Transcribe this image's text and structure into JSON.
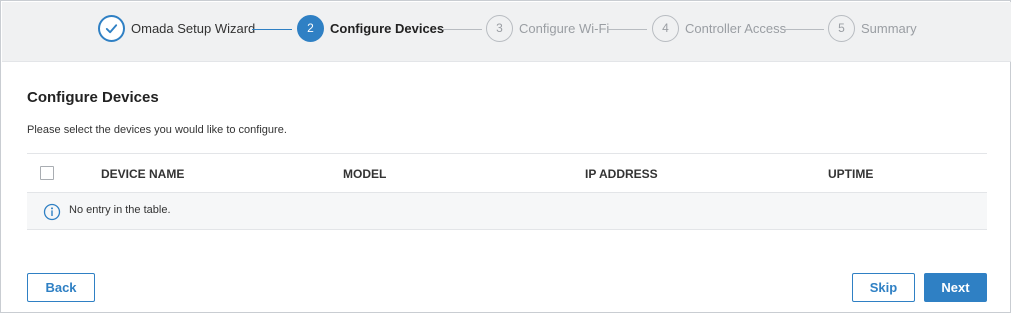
{
  "wizard": {
    "steps": [
      {
        "number": "",
        "label": "Omada Setup Wizard",
        "state": "done"
      },
      {
        "number": "2",
        "label": "Configure Devices",
        "state": "active"
      },
      {
        "number": "3",
        "label": "Configure Wi-Fi",
        "state": "todo"
      },
      {
        "number": "4",
        "label": "Controller Access",
        "state": "todo"
      },
      {
        "number": "5",
        "label": "Summary",
        "state": "todo"
      }
    ]
  },
  "main": {
    "title": "Configure Devices",
    "description": "Please select the devices you would like to configure.",
    "table": {
      "columns": [
        "DEVICE NAME",
        "MODEL",
        "IP ADDRESS",
        "UPTIME"
      ],
      "select_all_checked": false,
      "empty_message": "No entry in the table."
    }
  },
  "footer": {
    "back_label": "Back",
    "skip_label": "Skip",
    "next_label": "Next"
  },
  "colors": {
    "accent": "#2f80c4",
    "inactive": "#9a9ea3"
  },
  "icons": {
    "done_step": "checkmark-icon",
    "empty_state": "info-icon"
  }
}
